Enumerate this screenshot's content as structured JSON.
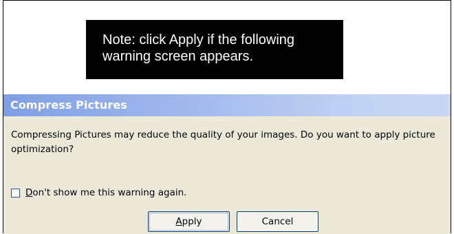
{
  "note": {
    "text": "Note: click Apply if the following\nwarning screen appears."
  },
  "dialog": {
    "title": "Compress Pictures",
    "message": "Compressing Pictures may reduce the quality of your images. Do you want to apply picture optimization?",
    "checkbox": {
      "mnemonic": "D",
      "label_rest": "on't show me this warning again.",
      "checked": false
    },
    "buttons": {
      "apply_mnemonic": "A",
      "apply_rest": "pply",
      "cancel": "Cancel"
    }
  },
  "colors": {
    "titlebar_start": "#7f9ee3",
    "titlebar_end": "#c9d7f3",
    "dialog_bg": "#ece9d8",
    "note_bg": "#000000"
  }
}
